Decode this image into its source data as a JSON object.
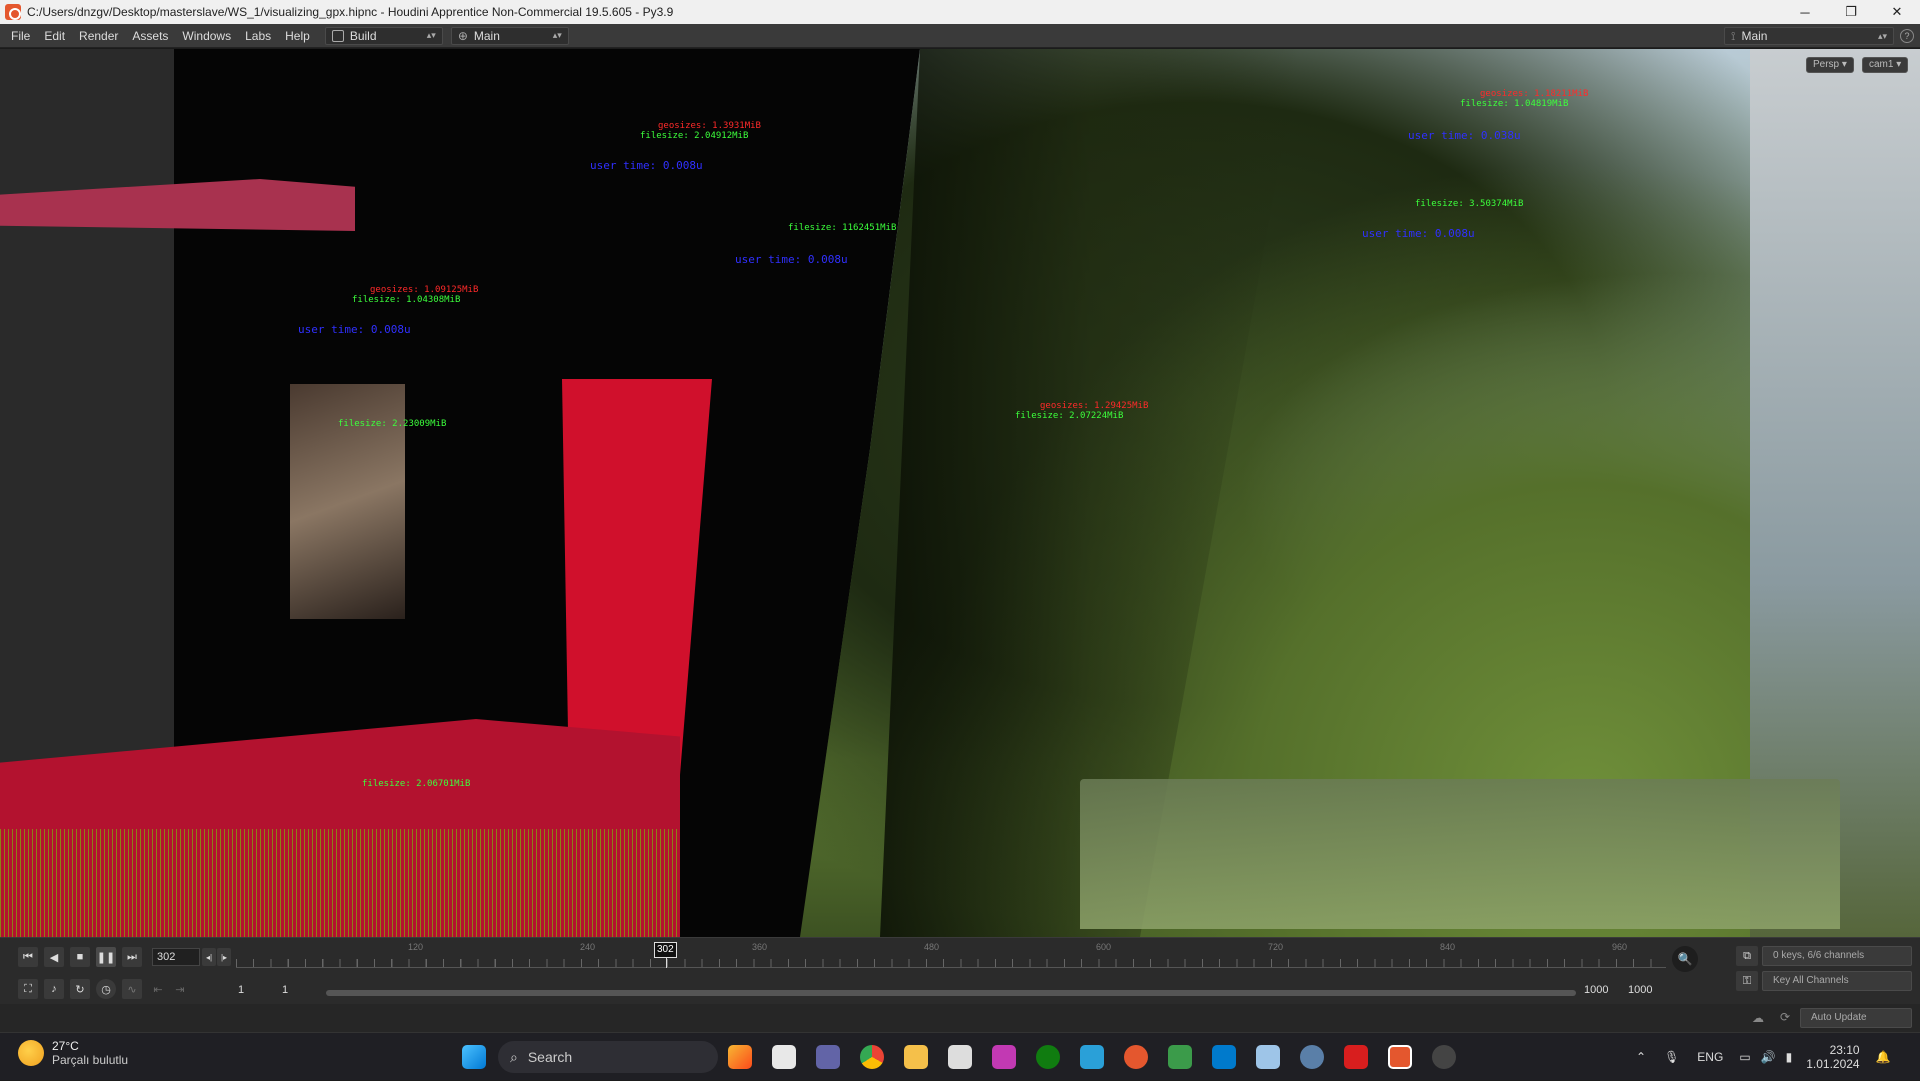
{
  "window": {
    "title": "C:/Users/dnzgv/Desktop/masterslave/WS_1/visualizing_gpx.hipnc - Houdini Apprentice Non-Commercial 19.5.605 - Py3.9",
    "controls": {
      "minimize": "─",
      "maximize": "❐",
      "close": "✕"
    }
  },
  "menubar": {
    "items": [
      "File",
      "Edit",
      "Render",
      "Assets",
      "Windows",
      "Labs",
      "Help"
    ],
    "build_dropdown": "Build",
    "main_dropdown": "Main",
    "desktop_dropdown": "Main"
  },
  "viewport": {
    "persp_button": "Persp ▾",
    "cam_button": "cam1 ▾",
    "annotations_red": [
      "geosizes: 1.3931MiB",
      "geosizes: 1.18211MiB",
      "geosizes: 1.09125MiB",
      "geosizes: 1.29425MiB"
    ],
    "annotations_green": [
      "filesize: 2.04912MiB",
      "filesize: 1.04308MiB",
      "filesize: 1162451MiB",
      "filesize: 3.50374MiB",
      "filesize: 2.07224MiB",
      "filesize: 1.04819MiB",
      "filesize: 2.23009MiB",
      "filesize: 2.06701MiB"
    ],
    "annotations_blue": [
      "user time: 0.008u",
      "user time: 0.038u",
      "user time: 0.008u",
      "user time: 0.008u",
      "user time: 0.008u"
    ]
  },
  "timeline": {
    "current_frame": "302",
    "cursor_label": "302",
    "tick_labels": [
      "120",
      "240",
      "360",
      "480",
      "600",
      "720",
      "840",
      "960"
    ],
    "start_frame": "1",
    "range_start": "1",
    "range_end": "1000",
    "end_frame": "1000",
    "keys_info": "0 keys, 6/6 channels",
    "key_all_channels": "Key All Channels",
    "auto_update": "Auto Update"
  },
  "taskbar": {
    "weather_temp": "27°C",
    "weather_desc": "Parçalı bulutlu",
    "search_label": "Search",
    "language": "ENG",
    "time": "23:10",
    "date": "1.01.2024"
  },
  "colors": {
    "houdini_accent": "#e4572e",
    "red_geo": "#c0163a",
    "annotation_red": "#ff2a2a",
    "annotation_green": "#3cff3c",
    "annotation_blue": "#3030ff"
  }
}
